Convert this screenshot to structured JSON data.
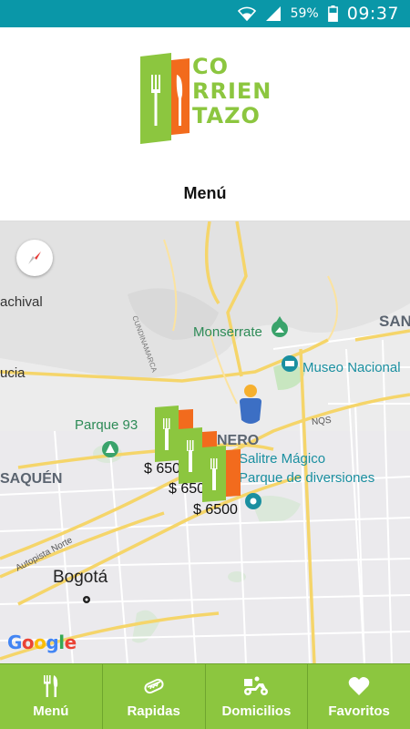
{
  "status": {
    "battery_pct": "59%",
    "time": "09:37"
  },
  "logo": {
    "line1": "CO",
    "line2": "RRIEN",
    "line3": "TAZO"
  },
  "header": {
    "title": "Menú"
  },
  "map": {
    "labels": {
      "achival": "achival",
      "ucia": "ucia",
      "parque93": "Parque 93",
      "saquen": "SAQUÉN",
      "monserrate": "Monserrate",
      "museo": "Museo Nacional",
      "san": "SAN",
      "nero": "NERO",
      "salitre1": "Salitre Mágico",
      "salitre2": "Parque de diversiones",
      "bogota": "Bogotá",
      "autopista": "Autopista Norte",
      "cundinamarca": "CUNDINAMARCA",
      "nqs": "NQS"
    },
    "prices": [
      "$ 6500",
      "$ 6500",
      "$ 6500"
    ],
    "google": {
      "g1": "G",
      "o1": "o",
      "o2": "o",
      "g2": "g",
      "l": "l",
      "e": "e"
    }
  },
  "nav": {
    "items": [
      {
        "label": "Menú",
        "icon": "fork-knife-icon"
      },
      {
        "label": "Rapidas",
        "icon": "hotdog-icon"
      },
      {
        "label": "Domicilios",
        "icon": "delivery-scooter-icon"
      },
      {
        "label": "Favoritos",
        "icon": "heart-icon"
      }
    ]
  },
  "colors": {
    "accent": "#8cc63f",
    "status_bar": "#0a97a8",
    "logo_orange": "#f26b1d"
  }
}
